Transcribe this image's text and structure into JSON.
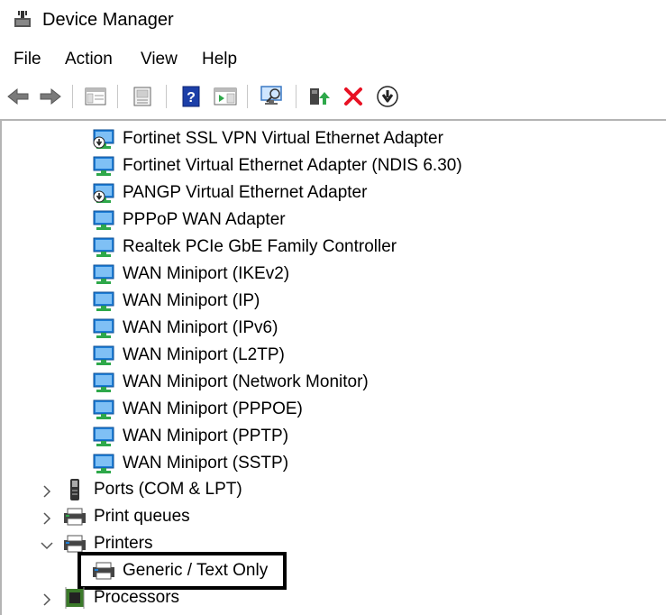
{
  "window": {
    "title": "Device Manager"
  },
  "menu": {
    "file": "File",
    "action": "Action",
    "view": "View",
    "help": "Help"
  },
  "toolbar": {
    "buttons": [
      "back-arrow-icon",
      "forward-arrow-icon",
      "console-tree-icon",
      "properties-icon",
      "help-icon",
      "action-pane-icon",
      "scan-hardware-icon",
      "update-driver-icon",
      "uninstall-device-icon",
      "disable-device-icon"
    ],
    "uninstall_color": "#e81123"
  },
  "tree": {
    "network_adapters": [
      {
        "label": "Fortinet SSL VPN Virtual Ethernet Adapter",
        "icon": "network-adapter-disabled-icon"
      },
      {
        "label": "Fortinet Virtual Ethernet Adapter (NDIS 6.30)",
        "icon": "network-adapter-icon"
      },
      {
        "label": "PANGP Virtual Ethernet Adapter",
        "icon": "network-adapter-disabled-icon"
      },
      {
        "label": "PPPoP WAN Adapter",
        "icon": "network-adapter-icon"
      },
      {
        "label": "Realtek PCIe GbE Family Controller",
        "icon": "network-adapter-icon"
      },
      {
        "label": "WAN Miniport (IKEv2)",
        "icon": "network-adapter-icon"
      },
      {
        "label": "WAN Miniport (IP)",
        "icon": "network-adapter-icon"
      },
      {
        "label": "WAN Miniport (IPv6)",
        "icon": "network-adapter-icon"
      },
      {
        "label": "WAN Miniport (L2TP)",
        "icon": "network-adapter-icon"
      },
      {
        "label": "WAN Miniport (Network Monitor)",
        "icon": "network-adapter-icon"
      },
      {
        "label": "WAN Miniport (PPPOE)",
        "icon": "network-adapter-icon"
      },
      {
        "label": "WAN Miniport (PPTP)",
        "icon": "network-adapter-icon"
      },
      {
        "label": "WAN Miniport (SSTP)",
        "icon": "network-adapter-icon"
      }
    ],
    "categories": {
      "ports": {
        "label": "Ports (COM & LPT)",
        "state": "collapsed"
      },
      "print_queues": {
        "label": "Print queues",
        "state": "collapsed"
      },
      "printers": {
        "label": "Printers",
        "state": "expanded"
      },
      "processors": {
        "label": "Processors",
        "state": "collapsed"
      }
    },
    "printers_children": [
      {
        "label": "Generic / Text Only",
        "selected": true
      }
    ]
  },
  "colors": {
    "adapter_blue": "#1e7fd8",
    "adapter_green": "#2ea84a",
    "highlight_border": "#000000"
  }
}
